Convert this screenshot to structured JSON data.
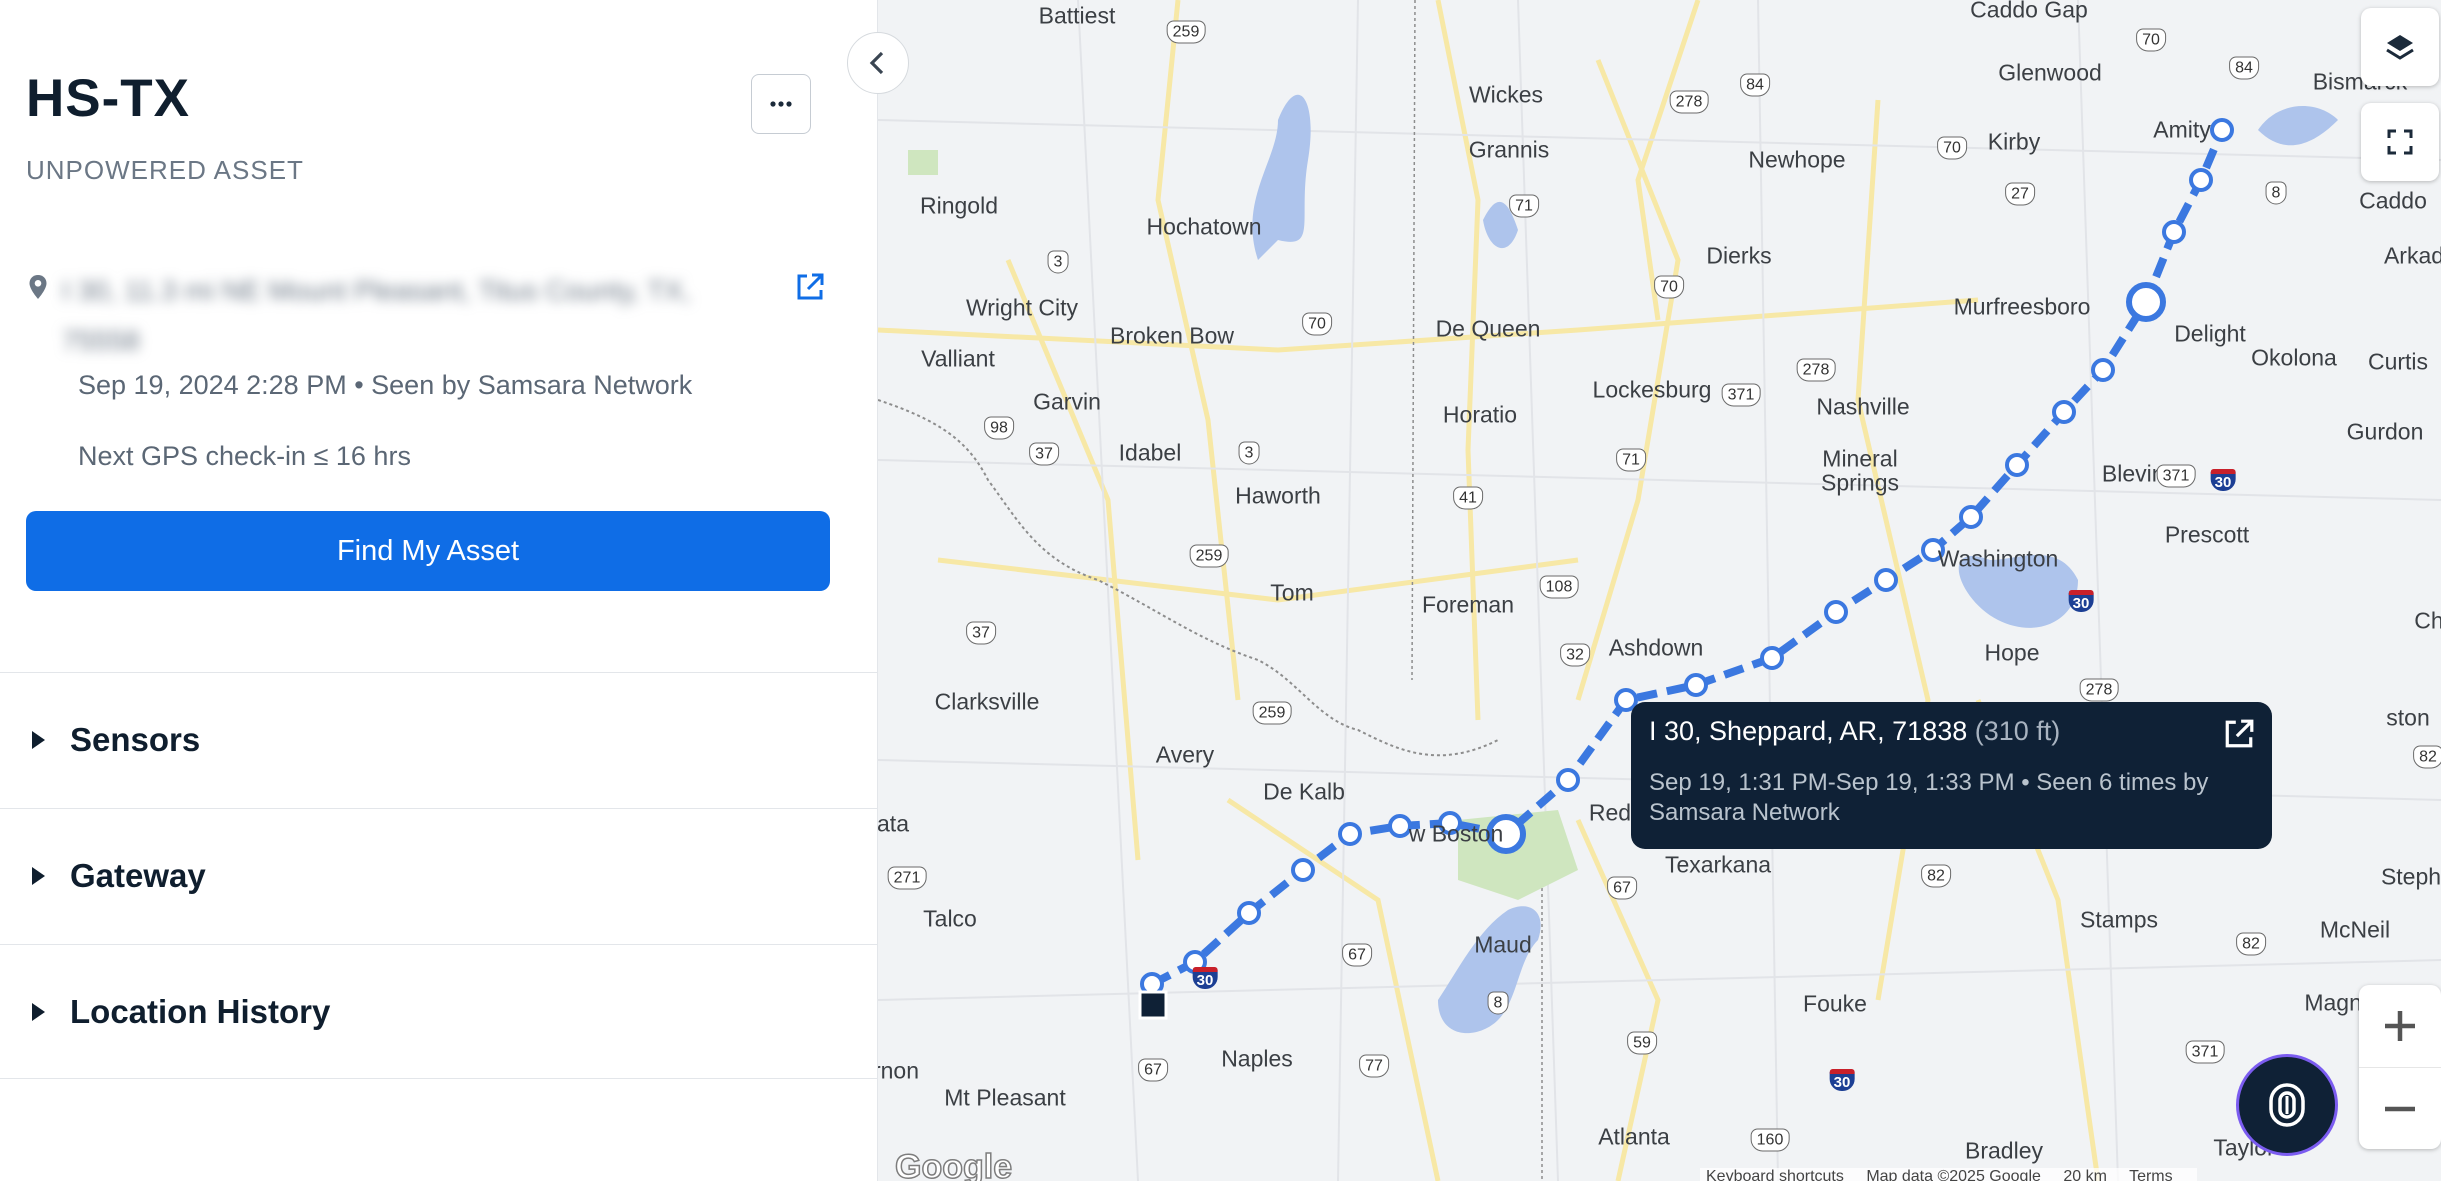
{
  "asset": {
    "title": "HS-TX",
    "subtitle": "UNPOWERED ASSET",
    "address": "I 30, 11.3 mi NE Mount Pleasant, Titus County, TX, 75558",
    "seen": "Sep 19, 2024 2:28 PM • Seen by Samsara Network",
    "next_checkin": "Next GPS check-in ≤ 16 hrs",
    "find_button": "Find My Asset",
    "more_label": "···"
  },
  "sections": [
    {
      "label": "Sensors"
    },
    {
      "label": "Gateway"
    },
    {
      "label": "Location History"
    }
  ],
  "tooltip": {
    "location": "I 30, Sheppard, AR, 71838",
    "distance": "(310 ft)",
    "detail": "Sep 19, 1:31 PM-Sep 19, 1:33 PM • Seen 6 times by Samsara Network"
  },
  "map": {
    "places": [
      "Battiest",
      "Caddo Gap",
      "Wickes",
      "Glenwood",
      "Bismarck",
      "Grannis",
      "Newhope",
      "Kirby",
      "Amity",
      "Ringold",
      "Hochatown",
      "Caddo",
      "Arkad",
      "Dierks",
      "Wright City",
      "Murfreesboro",
      "Broken Bow",
      "De Queen",
      "Delight",
      "Okolona",
      "Curtis",
      "Valliant",
      "Garvin",
      "Horatio",
      "Lockesburg",
      "Nashville",
      "Gurdon",
      "Idabel",
      "Mineral",
      "Springs",
      "Blevins",
      "Haworth",
      "Prescott",
      "Washington",
      "Tom",
      "Foreman",
      "Ashdown",
      "Hope",
      "Ch",
      "Clarksville",
      "Avery",
      "ston",
      "De Kalb",
      "w Boston",
      "Red",
      "Texarkana",
      "Stamps",
      "ata",
      "Steph",
      "Talco",
      "Maud",
      "McNeil",
      "Fouke",
      "Magnolia",
      "Naples",
      "Mt Pleasant",
      "rnon",
      "Atlanta",
      "Bradley",
      "Taylor"
    ],
    "shields": [
      "259",
      "70",
      "84",
      "278",
      "70",
      "84",
      "27",
      "71",
      "8",
      "3",
      "70",
      "70",
      "278",
      "371",
      "98",
      "37",
      "3",
      "71",
      "278",
      "371",
      "259",
      "41",
      "108",
      "37",
      "32",
      "259",
      "82",
      "271",
      "67",
      "82",
      "67",
      "8",
      "59",
      "82",
      "77",
      "67",
      "371",
      "160",
      "30",
      "30",
      "30",
      "30"
    ],
    "attribution": [
      "Keyboard shortcuts",
      "Map data ©2025 Google",
      "20 km",
      "Terms"
    ],
    "logo": "Google"
  },
  "colors": {
    "primary": "#0f6de6",
    "route": "#3b78e0",
    "tooltip_bg": "#0f2136",
    "text_dark": "#0f1e2e",
    "text_muted": "#6b7785",
    "water": "#aec4ec",
    "park": "#cfe6bf"
  },
  "icons": [
    "map-pin-icon",
    "open-external-icon",
    "chevron-left-icon",
    "layers-icon",
    "fullscreen-icon",
    "plus-icon",
    "minus-icon",
    "assistant-icon",
    "caret-right-icon"
  ]
}
